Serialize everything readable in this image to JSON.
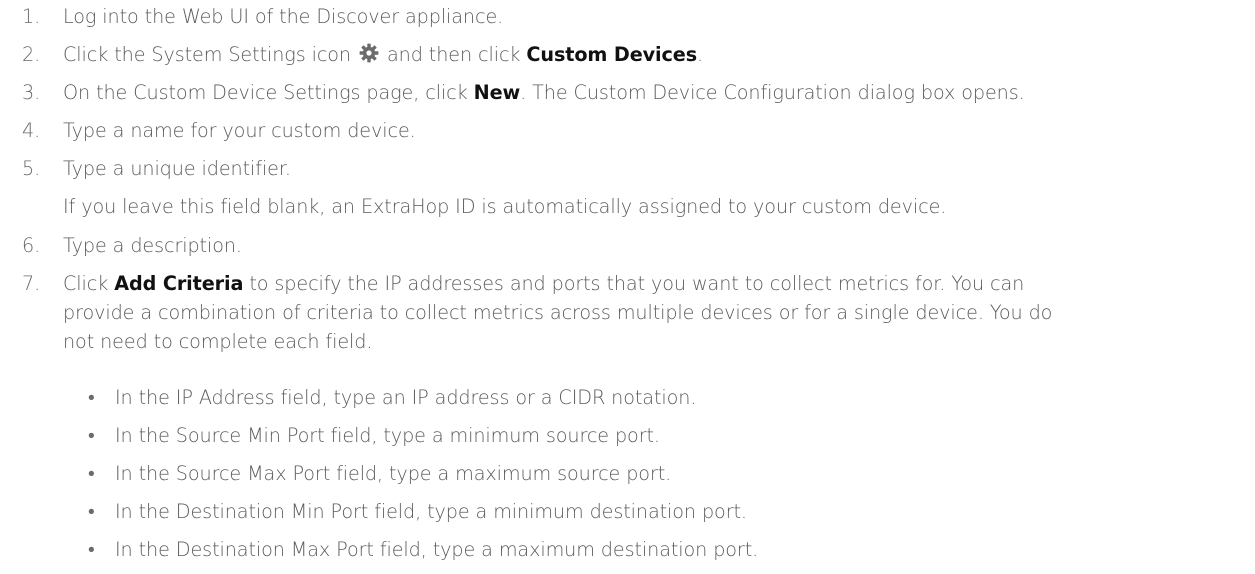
{
  "steps": [
    {
      "num": "1.",
      "text": "Log into the Web UI of the Discover appliance."
    },
    {
      "num": "2.",
      "pre": "Click the System Settings icon",
      "mid": "and then click",
      "bold": "Custom Devices",
      "post": "."
    },
    {
      "num": "3.",
      "pre": "On the Custom Device Settings page, click",
      "bold": "New",
      "post": ". The Custom Device Configuration dialog box opens."
    },
    {
      "num": "4.",
      "text": "Type a name for your custom device."
    },
    {
      "num": "5.",
      "text": "Type a unique identifier.",
      "note": "If you leave this field blank, an ExtraHop ID is automatically assigned to your custom device."
    },
    {
      "num": "6.",
      "text": "Type a description."
    },
    {
      "num": "7.",
      "pre": "Click",
      "bold": "Add Criteria",
      "line1_rest": "to specify the IP addresses and ports that you want to collect metrics for. You can",
      "line2": "provide a combination of criteria to collect metrics across multiple devices or for a single device. You do",
      "line3": "not need to complete each field.",
      "bullets": [
        "In the IP Address field, type an IP address or a CIDR notation.",
        "In the Source Min Port field, type a minimum source port.",
        "In the Source Max Port field, type a maximum source port.",
        "In the Destination Min Port field, type a minimum destination port.",
        "In the Destination Max Port field, type a maximum destination port."
      ]
    }
  ],
  "bullet_glyph": "•",
  "icons": {
    "settings": "gear-icon"
  },
  "colors": {
    "text": "#5a5a5a",
    "bold": "#111111",
    "icon": "#6b6b6b"
  }
}
